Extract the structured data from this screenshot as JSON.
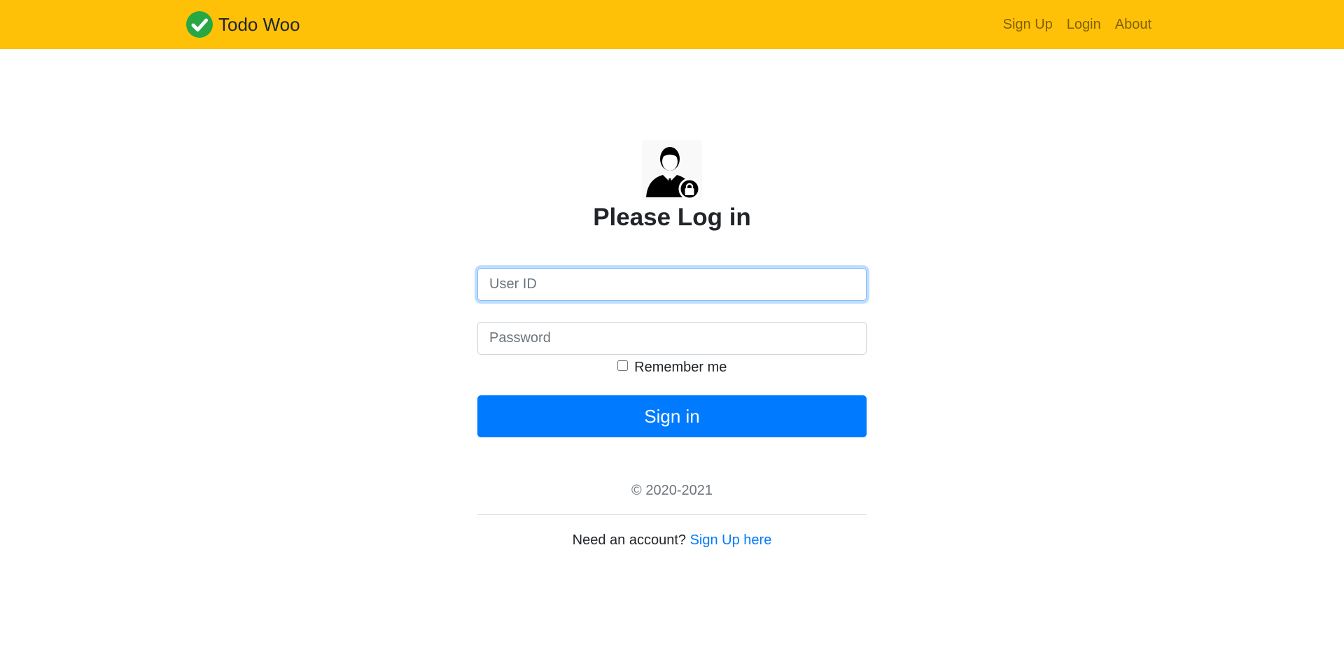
{
  "navbar": {
    "brand_label": "Todo Woo",
    "brand_icon": "check-circle-icon",
    "background_color": "#ffc107",
    "links": [
      {
        "label": "Sign Up"
      },
      {
        "label": "Login"
      },
      {
        "label": "About"
      }
    ]
  },
  "login": {
    "avatar_icon": "user-lock-icon",
    "title": "Please Log in",
    "userid_placeholder": "User ID",
    "password_placeholder": "Password",
    "remember_label": "Remember me",
    "signin_label": "Sign in",
    "accent_color": "#007bff"
  },
  "footer": {
    "copyright": "© 2020-2021",
    "need_account": "Need an account?",
    "signup_link": "Sign Up here"
  }
}
